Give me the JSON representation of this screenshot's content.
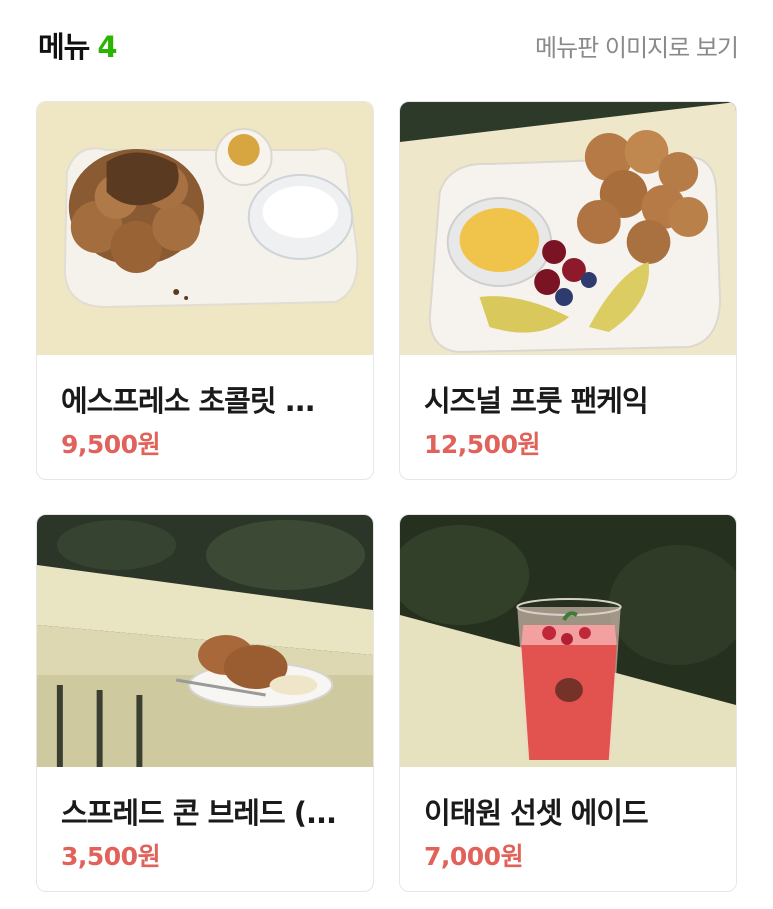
{
  "header": {
    "title": "메뉴",
    "count": "4",
    "menu_board_link": "메뉴판 이미지로 보기"
  },
  "menu_items": [
    {
      "name": "에스프레소 초콜릿 ...",
      "price": "9,500원",
      "image": "espresso-chocolate-pancake-photo"
    },
    {
      "name": "시즈널 프룻 팬케익",
      "price": "12,500원",
      "image": "seasonal-fruit-pancake-photo"
    },
    {
      "name": "스프레드 콘 브레드 (...",
      "price": "3,500원",
      "image": "spread-corn-bread-photo"
    },
    {
      "name": "이태원 선셋 에이드",
      "price": "7,000원",
      "image": "itaewon-sunset-ade-photo"
    }
  ],
  "colors": {
    "count_accent": "#2db400",
    "price": "#e0625a",
    "link_gray": "#8a8a8a"
  }
}
